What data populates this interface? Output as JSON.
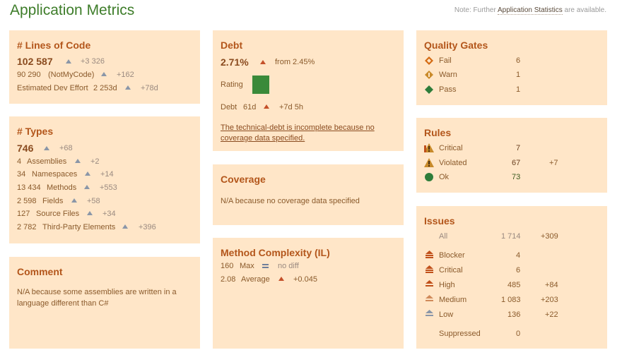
{
  "title": "Application Metrics",
  "note": {
    "prefix": "Note: Further ",
    "link": "Application Statistics",
    "suffix": " are available."
  },
  "loc": {
    "header": "# Lines of Code",
    "value": "102 587",
    "delta": "+3 326",
    "rows": [
      {
        "value": "90 290",
        "label": "(NotMyCode)",
        "delta": "+162"
      },
      {
        "value": "Estimated Dev Effort",
        "label": "2 253d",
        "delta": "+78d"
      }
    ]
  },
  "types": {
    "header": "# Types",
    "value": "746",
    "delta": "+68",
    "rows": [
      {
        "value": "4",
        "label": "Assemblies",
        "delta": "+2"
      },
      {
        "value": "34",
        "label": "Namespaces",
        "delta": "+14"
      },
      {
        "value": "13 434",
        "label": "Methods",
        "delta": "+553"
      },
      {
        "value": "2 598",
        "label": "Fields",
        "delta": "+58"
      },
      {
        "value": "127",
        "label": "Source Files",
        "delta": "+34"
      },
      {
        "value": "2 782",
        "label": "Third-Party Elements",
        "delta": "+396"
      }
    ]
  },
  "comment": {
    "header": "Comment",
    "text1": "N/A because some assemblies are written in a",
    "text2": "language different than C#"
  },
  "debt": {
    "header": "Debt",
    "value": "2.71%",
    "from": "from 2.45%",
    "rating_label": "Rating",
    "rating_color": "#3a8a3a",
    "debt_label": "Debt",
    "debt_value": "61d",
    "debt_delta": "+7d 5h",
    "link1": "The technical-debt is incomplete because no",
    "link2": "coverage data specified."
  },
  "coverage": {
    "header": "Coverage",
    "text": "N/A because no coverage data specified"
  },
  "complexity": {
    "header": "Method Complexity (IL)",
    "rows": [
      {
        "value": "160",
        "label": "Max",
        "delta": "no diff",
        "icon": "equal-icon"
      },
      {
        "value": "2.08",
        "label": "Average",
        "delta": "+0.045",
        "icon": "arrow-up-icon"
      }
    ]
  },
  "quality_gates": {
    "header": "Quality Gates",
    "rows": [
      {
        "label": "Fail",
        "count": "6",
        "icon": "fail-diamond-icon",
        "color": "#d46a12"
      },
      {
        "label": "Warn",
        "count": "1",
        "icon": "warn-diamond-icon",
        "color": "#c98a2a"
      },
      {
        "label": "Pass",
        "count": "1",
        "icon": "pass-diamond-icon",
        "color": "#2e7d3a"
      }
    ]
  },
  "rules": {
    "header": "Rules",
    "rows": [
      {
        "label": "Critical",
        "count": "7",
        "delta": "",
        "icon": "critical-warning-icon"
      },
      {
        "label": "Violated",
        "count": "67",
        "delta": "+7",
        "icon": "warning-icon"
      },
      {
        "label": "Ok",
        "count": "73",
        "delta": "",
        "icon": "ok-circle-icon"
      }
    ]
  },
  "issues": {
    "header": "Issues",
    "all": {
      "label": "All",
      "count": "1 714",
      "delta": "+309"
    },
    "rows": [
      {
        "label": "Blocker",
        "count": "4",
        "delta": "",
        "icon": "blocker-icon",
        "color": "#c0501a"
      },
      {
        "label": "Critical",
        "count": "6",
        "delta": "",
        "icon": "critical-icon",
        "color": "#c0501a"
      },
      {
        "label": "High",
        "count": "485",
        "delta": "+84",
        "icon": "high-icon",
        "color": "#c0501a"
      },
      {
        "label": "Medium",
        "count": "1 083",
        "delta": "+203",
        "icon": "medium-icon",
        "color": "#d08a5a"
      },
      {
        "label": "Low",
        "count": "136",
        "delta": "+22",
        "icon": "low-icon",
        "color": "#8a96a8"
      }
    ],
    "suppressed": {
      "label": "Suppressed",
      "count": "0"
    }
  }
}
